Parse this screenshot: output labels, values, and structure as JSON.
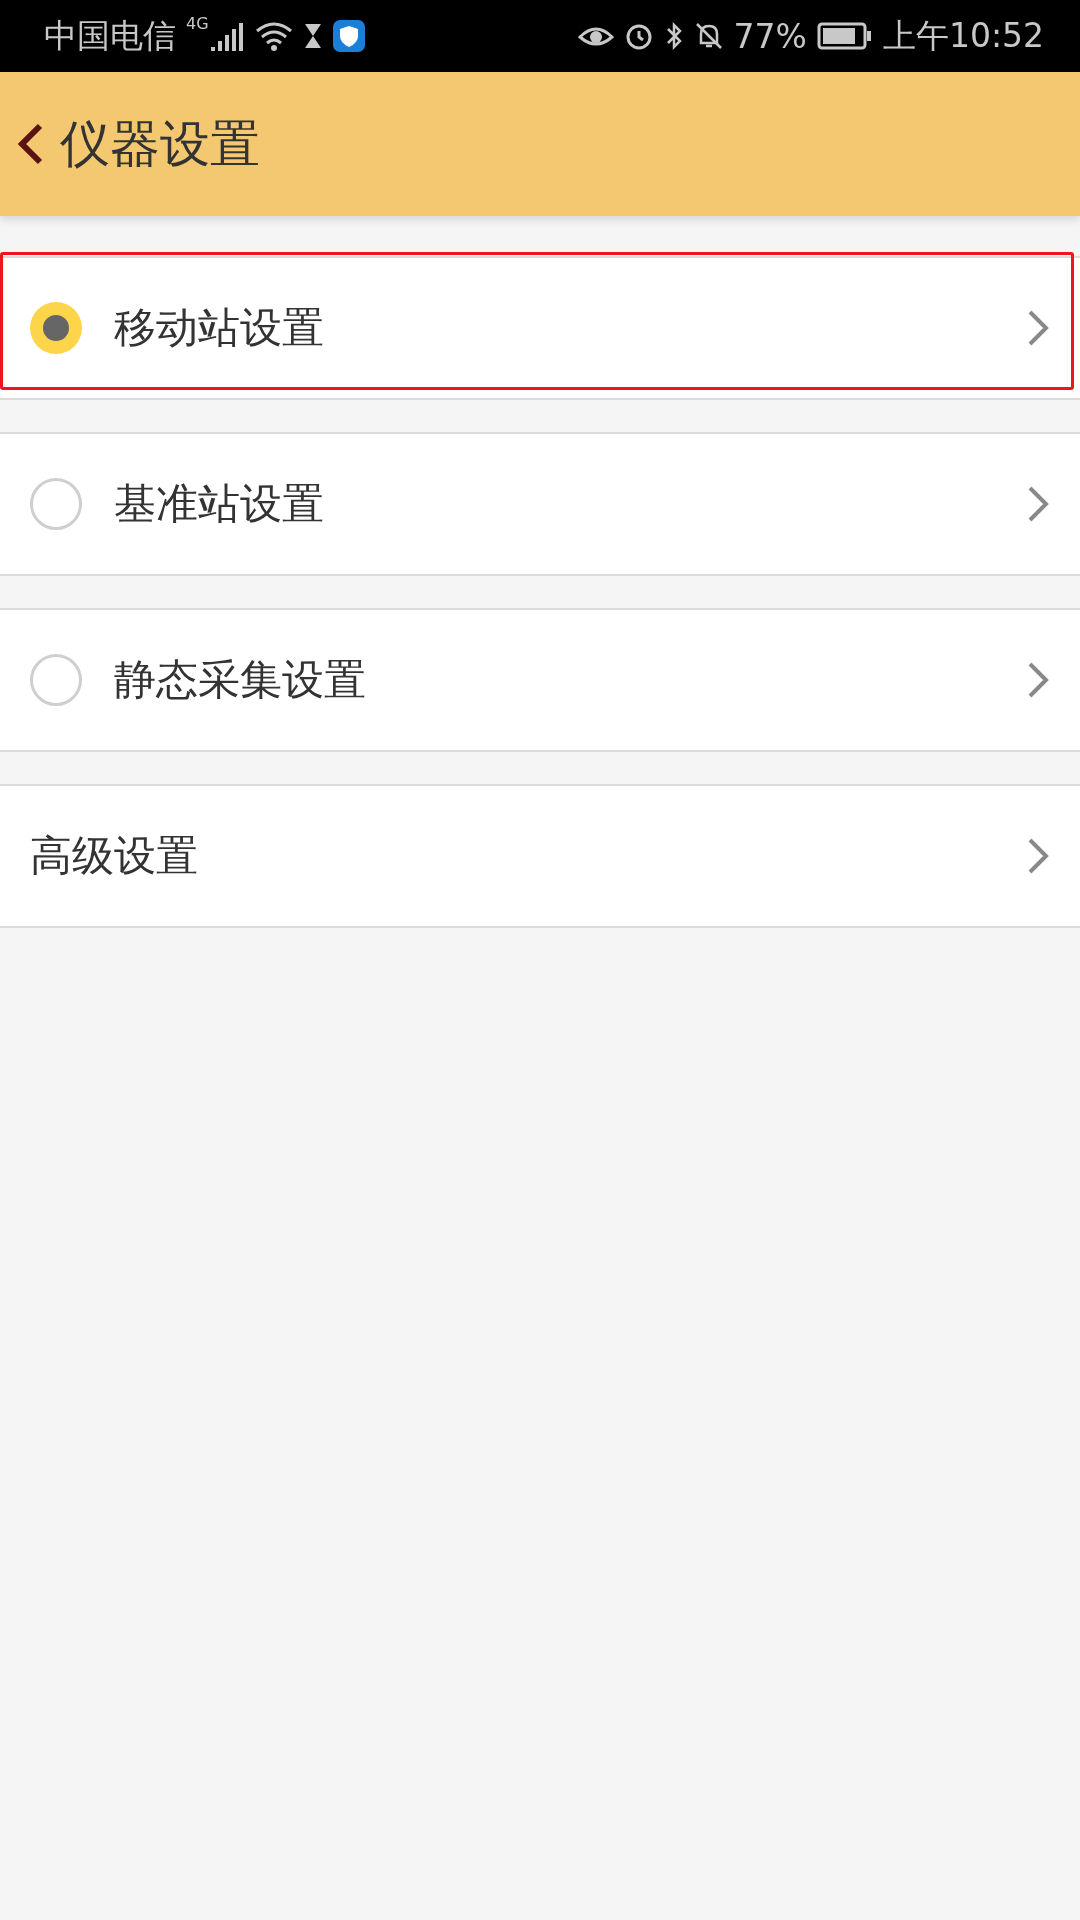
{
  "status_bar": {
    "carrier": "中国电信",
    "network": "4G",
    "battery": "77%",
    "time": "上午10:52"
  },
  "header": {
    "title": "仪器设置"
  },
  "items": [
    {
      "kind": "radio",
      "label": "移动站设置",
      "selected": true,
      "highlighted": true
    },
    {
      "kind": "radio",
      "label": "基准站设置",
      "selected": false,
      "highlighted": false
    },
    {
      "kind": "radio",
      "label": "静态采集设置",
      "selected": false,
      "highlighted": false
    },
    {
      "kind": "plain",
      "label": "高级设置",
      "highlighted": false
    }
  ]
}
